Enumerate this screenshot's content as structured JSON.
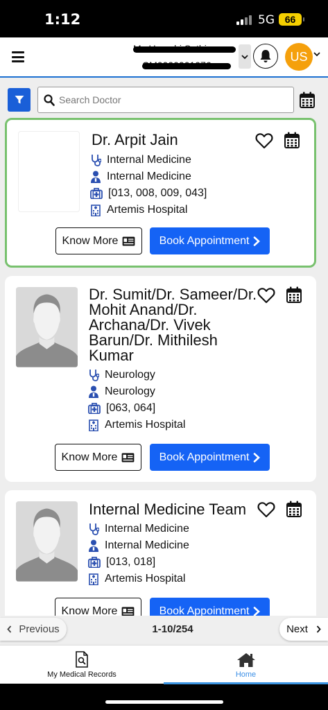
{
  "status_bar": {
    "time": "1:12",
    "network": "5G",
    "battery": "66"
  },
  "header": {
    "user_name": "Ms Urvashi Sethi...",
    "user_id": "CM0000001076",
    "avatar_initials": "US"
  },
  "search": {
    "placeholder": "Search Doctor"
  },
  "doctors": [
    {
      "name": "Dr. Arpit Jain",
      "speciality": "Internal Medicine",
      "department": "Internal Medicine",
      "codes": "[013, 008, 009, 043]",
      "hospital": "Artemis Hospital"
    },
    {
      "name_lines": [
        "Dr. Sumit/Dr. Sameer/Dr.",
        "Mohit Anand/Dr.",
        "Archana/Dr. Vivek",
        "Barun/Dr. Mithilesh",
        "Kumar"
      ],
      "speciality": "Neurology",
      "department": "Neurology",
      "codes": "[063, 064]",
      "hospital": "Artemis Hospital"
    },
    {
      "name": "Internal Medicine Team",
      "speciality": "Internal Medicine",
      "department": "Internal Medicine",
      "codes": "[013, 018]",
      "hospital": "Artemis Hospital"
    }
  ],
  "buttons": {
    "know_more": "Know More",
    "book": "Book Appointment"
  },
  "pagination": {
    "prev": "Previous",
    "next": "Next",
    "info": "1-10/254"
  },
  "tabs": {
    "records": "My Medical Records",
    "home": "Home"
  },
  "colors": {
    "primary": "#1563f5",
    "accent": "#f5a00c",
    "selected_border": "#78c16e"
  },
  "icons": [
    "menu-icon",
    "bell-icon",
    "filter-icon",
    "search-icon",
    "calendar-icon",
    "heart-icon",
    "stethoscope-icon",
    "doctor-icon",
    "medical-kit-icon",
    "hospital-icon",
    "id-card-icon",
    "chevron-right-icon",
    "records-icon",
    "home-icon"
  ]
}
